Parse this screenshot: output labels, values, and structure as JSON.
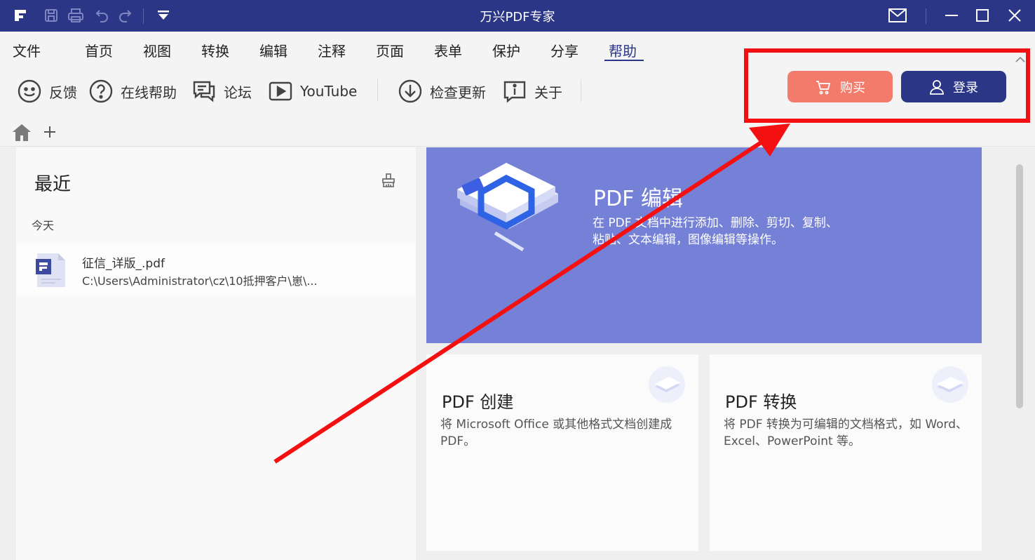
{
  "window": {
    "title": "万兴PDF专家",
    "accent": "#2b3687"
  },
  "menu": {
    "items": [
      {
        "label": "文件"
      },
      {
        "label": "首页"
      },
      {
        "label": "视图"
      },
      {
        "label": "转换"
      },
      {
        "label": "编辑"
      },
      {
        "label": "注释"
      },
      {
        "label": "页面"
      },
      {
        "label": "表单"
      },
      {
        "label": "保护"
      },
      {
        "label": "分享"
      },
      {
        "label": "帮助",
        "active": true
      }
    ]
  },
  "ribbon": {
    "feedback": "反馈",
    "online_help": "在线帮助",
    "forum": "论坛",
    "youtube": "YouTube",
    "check_update": "检查更新",
    "about": "关于",
    "buy": "购买",
    "login": "登录",
    "buy_color": "#f27b6c"
  },
  "recent": {
    "heading": "最近",
    "day_group": "今天",
    "files": [
      {
        "name": "征信_详版_.pdf",
        "path": "C:\\Users\\Administrator\\cz\\10抵押客户\\崽\\..."
      }
    ]
  },
  "features": {
    "edit": {
      "title": "PDF 编辑",
      "desc": "在 PDF 文档中进行添加、删除、剪切、复制、粘贴、文本编辑，图像编辑等操作。",
      "bg": "#7580d7"
    },
    "create": {
      "title": "PDF 创建",
      "desc": "将 Microsoft Office 或其他格式文档创建成PDF。"
    },
    "convert": {
      "title": "PDF 转换",
      "desc": "将 PDF 转换为可编辑的文档格式，如 Word、Excel、PowerPoint 等。"
    }
  },
  "annotation": {
    "color": "#f41010"
  }
}
